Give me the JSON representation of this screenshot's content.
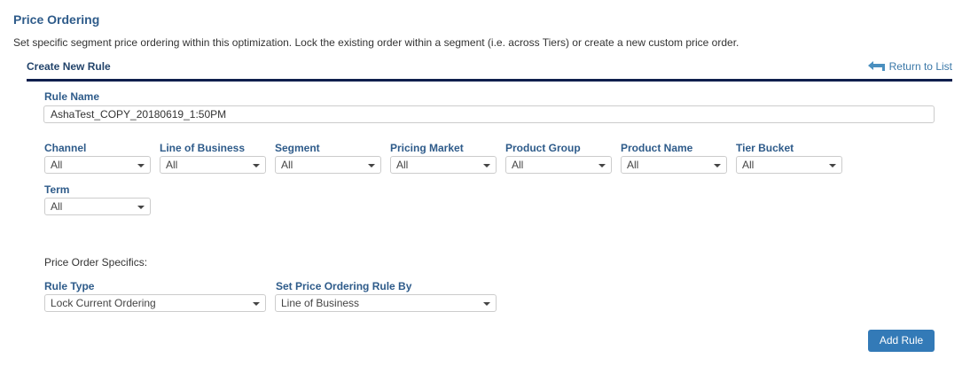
{
  "header": {
    "title": "Price Ordering",
    "description": "Set specific segment price ordering within this optimization. Lock the existing order within a segment (i.e. across Tiers) or create a new custom price order."
  },
  "section": {
    "title": "Create New Rule",
    "return_label": "Return to List"
  },
  "rule_name": {
    "label": "Rule Name",
    "value": "AshaTest_COPY_20180619_1:50PM"
  },
  "filters": [
    {
      "label": "Channel",
      "value": "All"
    },
    {
      "label": "Line of Business",
      "value": "All"
    },
    {
      "label": "Segment",
      "value": "All"
    },
    {
      "label": "Pricing Market",
      "value": "All"
    },
    {
      "label": "Product Group",
      "value": "All"
    },
    {
      "label": "Product Name",
      "value": "All"
    },
    {
      "label": "Tier Bucket",
      "value": "All"
    },
    {
      "label": "Term",
      "value": "All"
    }
  ],
  "specifics": {
    "heading": "Price Order Specifics:",
    "rule_type": {
      "label": "Rule Type",
      "value": "Lock Current Ordering"
    },
    "rule_by": {
      "label": "Set Price Ordering Rule By",
      "value": "Line of Business"
    }
  },
  "actions": {
    "add_rule": "Add Rule"
  }
}
